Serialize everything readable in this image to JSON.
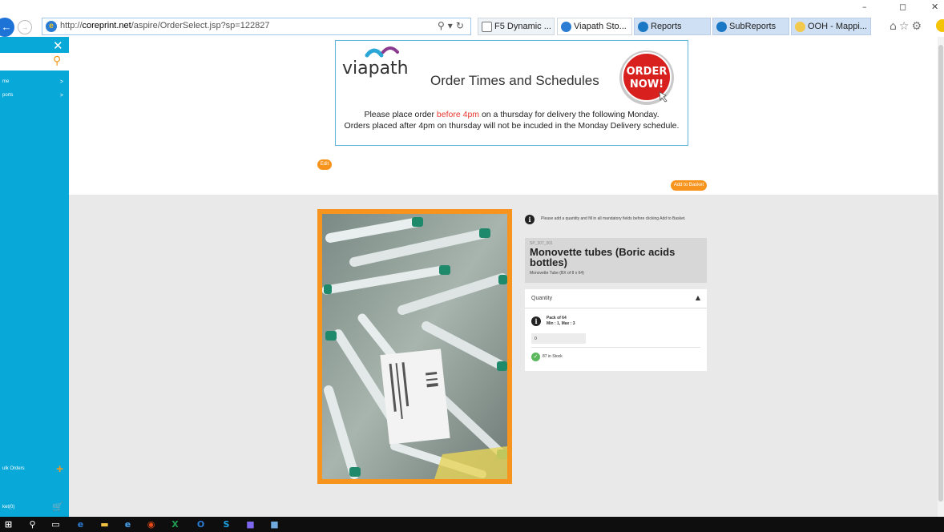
{
  "browser": {
    "url_prefix": "http://",
    "url_domain": "coreprint.net",
    "url_path": "/aspire/OrderSelect.jsp?sp=122827",
    "tabs": [
      {
        "label": "F5 Dynamic ..."
      },
      {
        "label": "Viapath Sto...",
        "close": "×"
      },
      {
        "label": "Reports"
      },
      {
        "label": "SubReports"
      },
      {
        "label": "OOH - Mappi..."
      }
    ],
    "window_controls": [
      "–",
      "◻",
      "✕"
    ]
  },
  "sidebar": {
    "items": [
      {
        "label": "me"
      },
      {
        "label": "ports"
      },
      {
        "label": "ulk Orders"
      },
      {
        "label": "ket(0)"
      }
    ]
  },
  "banner": {
    "logo_text": "viapath",
    "title": "Order Times and Schedules",
    "badge_line1": "ORDER",
    "badge_line2": "NOW!",
    "line1_pre": "Please place order ",
    "line1_red": "before 4pm",
    "line1_post": " on a thursday for delivery the following Monday.",
    "line2": "Orders placed after 4pm on thursday will not be incuded in the Monday Delivery schedule."
  },
  "buttons": {
    "edit": "Edit",
    "add_to_basket": "Add to Basket"
  },
  "product": {
    "mandatory_note": "Please add a quantity and fill in all mandatory fields before clicking Add to Basket.",
    "code": "SP_307_001",
    "title": "Monovette tubes (Boric acids bottles)",
    "subtitle": "Monovette Tube (BX of 8 x 64)",
    "quantity_label": "Quantity",
    "pack_of": "Pack of 64",
    "min_max": "Min : 1, Max : 3",
    "quantity_value": "0",
    "stock": "87 in Stock"
  },
  "colors": {
    "sidebar": "#08a8d8",
    "accent_orange": "#f7941d",
    "stock_green": "#5cb85c",
    "highlight_red": "#e8362d"
  }
}
